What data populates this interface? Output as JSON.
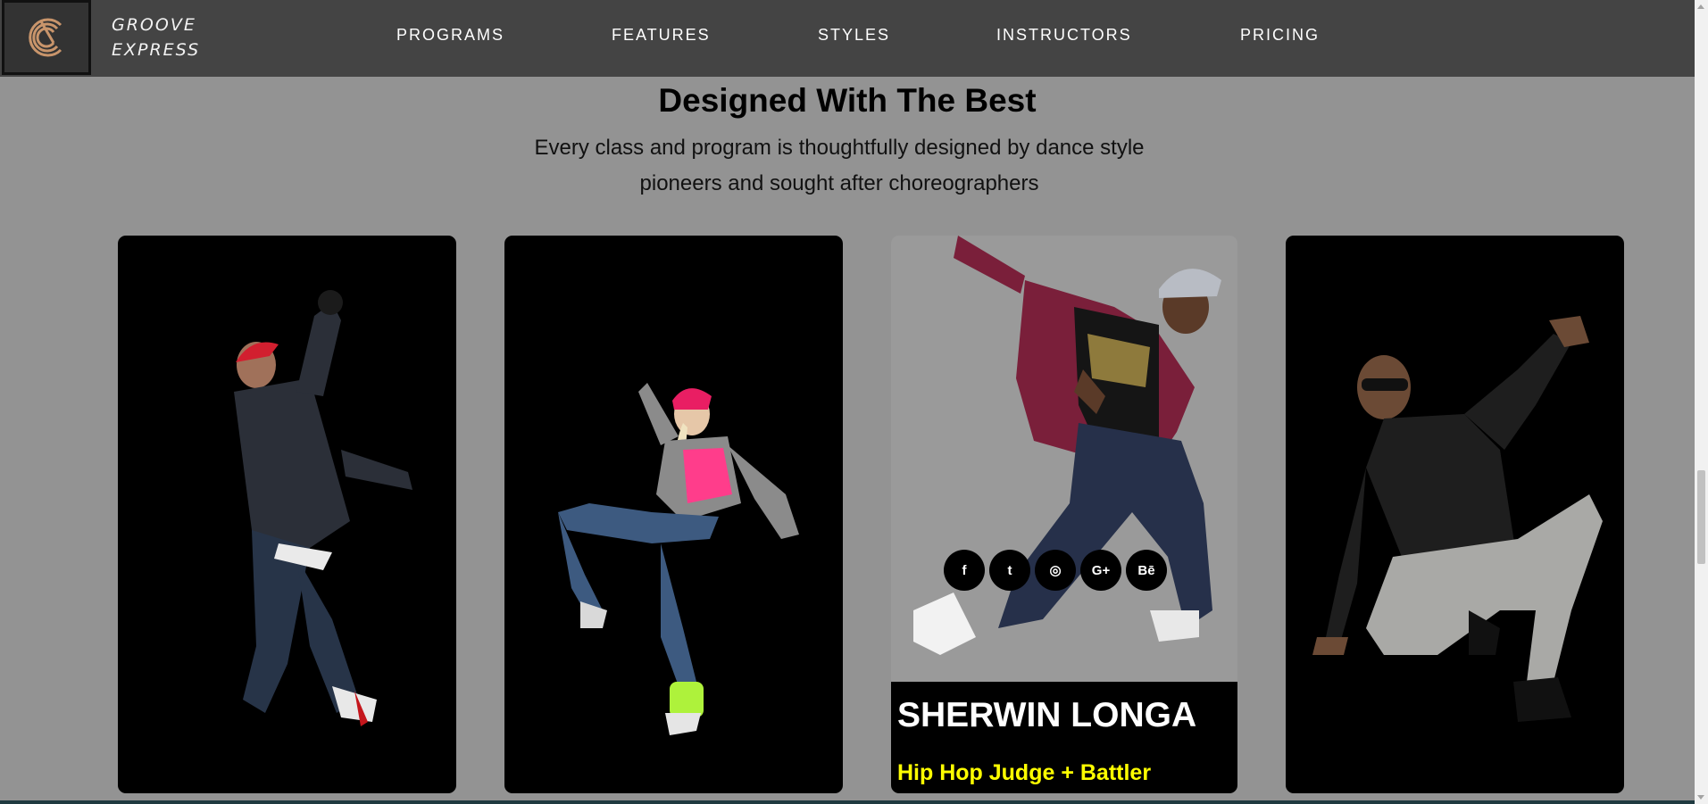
{
  "brand": {
    "line1": "GROOVE",
    "line2": "EXPRESS"
  },
  "nav": {
    "programs": "PROGRAMS",
    "features": "FEATURES",
    "styles": "STYLES",
    "instructors": "INSTRUCTORS",
    "pricing": "PRICING"
  },
  "section": {
    "title": "Designed With The Best",
    "subtitle": "Every class and program is thoughtfully designed by dance style pioneers and sought after choreographers"
  },
  "featured_instructor": {
    "name": "SHERWIN LONGA",
    "role": "Hip Hop Judge + Battler"
  },
  "socials": {
    "facebook": "f",
    "twitter": "t",
    "instagram": "◎",
    "googleplus": "G+",
    "behance": "Bē"
  },
  "colors": {
    "navbar": "#444444",
    "page_bg": "#939393",
    "role_text": "#ffff00",
    "logo_accent": "#c9956b"
  }
}
